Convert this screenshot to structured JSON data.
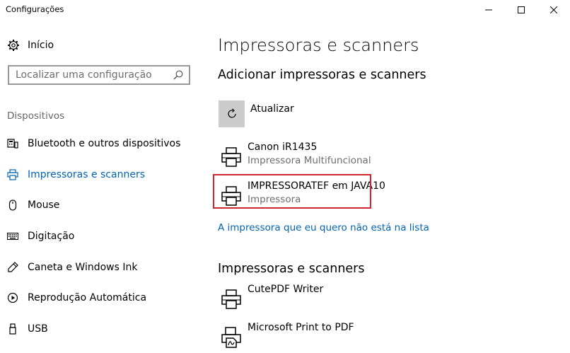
{
  "window": {
    "title": "Configurações",
    "controls": [
      "minimize-icon",
      "maximize-icon",
      "close-icon"
    ]
  },
  "sidebar": {
    "home_label": "Início",
    "search_placeholder": "Localizar uma configuração",
    "section_label": "Dispositivos",
    "items": [
      {
        "label": "Bluetooth e outros dispositivos",
        "icon": "bluetooth-devices-icon",
        "active": false
      },
      {
        "label": "Impressoras e scanners",
        "icon": "printer-icon",
        "active": true
      },
      {
        "label": "Mouse",
        "icon": "mouse-icon",
        "active": false
      },
      {
        "label": "Digitação",
        "icon": "keyboard-icon",
        "active": false
      },
      {
        "label": "Caneta e Windows Ink",
        "icon": "pen-icon",
        "active": false
      },
      {
        "label": "Reprodução Automática",
        "icon": "autoplay-icon",
        "active": false
      },
      {
        "label": "USB",
        "icon": "usb-icon",
        "active": false
      }
    ]
  },
  "main": {
    "title": "Impressoras e scanners",
    "add_heading": "Adicionar impressoras e scanners",
    "refresh_label": "Atualizar",
    "discovered": [
      {
        "name": "Canon iR1435",
        "type": "Impressora Multifuncional"
      },
      {
        "name": "IMPRESSORATEF em JAVA10",
        "type": "Impressora",
        "highlighted": true
      }
    ],
    "not_listed_link": "A impressora que eu quero não está na lista",
    "installed_heading": "Impressoras e scanners",
    "installed": [
      {
        "name": "CutePDF Writer",
        "icon": "printer-icon"
      },
      {
        "name": "Microsoft Print to PDF",
        "icon": "pdf-printer-icon"
      }
    ]
  },
  "colors": {
    "accent": "#0063b1",
    "highlight_border": "#d0262d",
    "refresh_tile": "#cccccc",
    "secondary_text": "#6d6d6d"
  }
}
